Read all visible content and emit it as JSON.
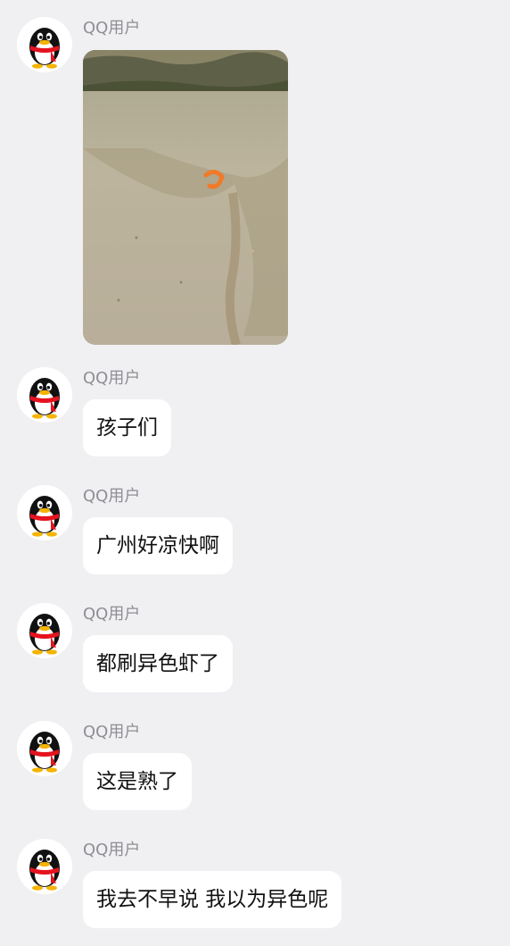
{
  "chat": {
    "sender_name": "QQ用户",
    "messages": [
      {
        "type": "image",
        "sender": "QQ用户",
        "image_desc": "photo of shallow water with a small orange shrimp"
      },
      {
        "type": "text",
        "sender": "QQ用户",
        "text": "孩子们"
      },
      {
        "type": "text",
        "sender": "QQ用户",
        "text": "广州好凉快啊"
      },
      {
        "type": "text",
        "sender": "QQ用户",
        "text": "都刷异色虾了"
      },
      {
        "type": "text",
        "sender": "QQ用户",
        "text": "这是熟了"
      },
      {
        "type": "text",
        "sender": "QQ用户",
        "text": "我去不早说 我以为异色呢"
      }
    ]
  },
  "icons": {
    "avatar": "qq-penguin-avatar-icon"
  },
  "colors": {
    "background": "#f0f0f3",
    "bubble": "#ffffff",
    "sender_text": "#8e8e93",
    "message_text": "#111111"
  }
}
